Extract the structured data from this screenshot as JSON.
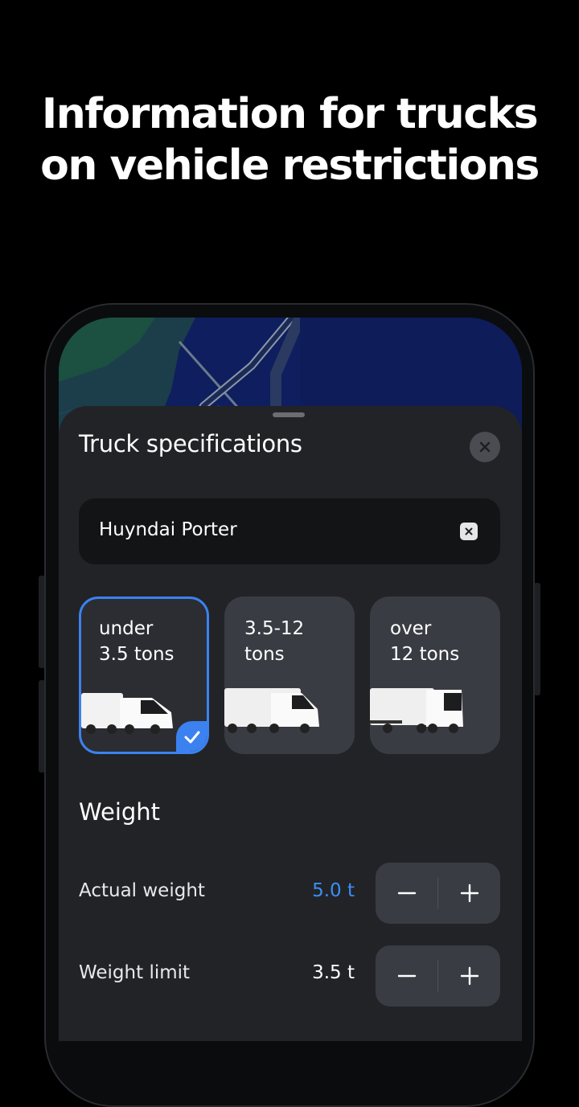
{
  "headline": {
    "line1": "Information for trucks",
    "line2": "on vehicle restrictions"
  },
  "sheet": {
    "title": "Truck specifications",
    "search_value": "Huyndai Porter",
    "vehicle_classes": [
      {
        "label": "under\n3.5 tons",
        "selected": true
      },
      {
        "label": "3.5-12\ntons",
        "selected": false
      },
      {
        "label": "over\n12 tons",
        "selected": false
      }
    ],
    "weight": {
      "section_title": "Weight",
      "rows": [
        {
          "label": "Actual weight",
          "value": "5.0 t"
        },
        {
          "label": "Weight limit",
          "value": "3.5 t"
        }
      ]
    }
  },
  "colors": {
    "accent": "#3b82f0",
    "sheet_bg": "#222327",
    "card_bg": "#3a3c43",
    "map_water": "#0f1e5e",
    "map_land": "#1b4a3e"
  },
  "icons": [
    "close-icon",
    "clear-icon",
    "check-icon",
    "minus-icon",
    "plus-icon",
    "truck-icon"
  ]
}
